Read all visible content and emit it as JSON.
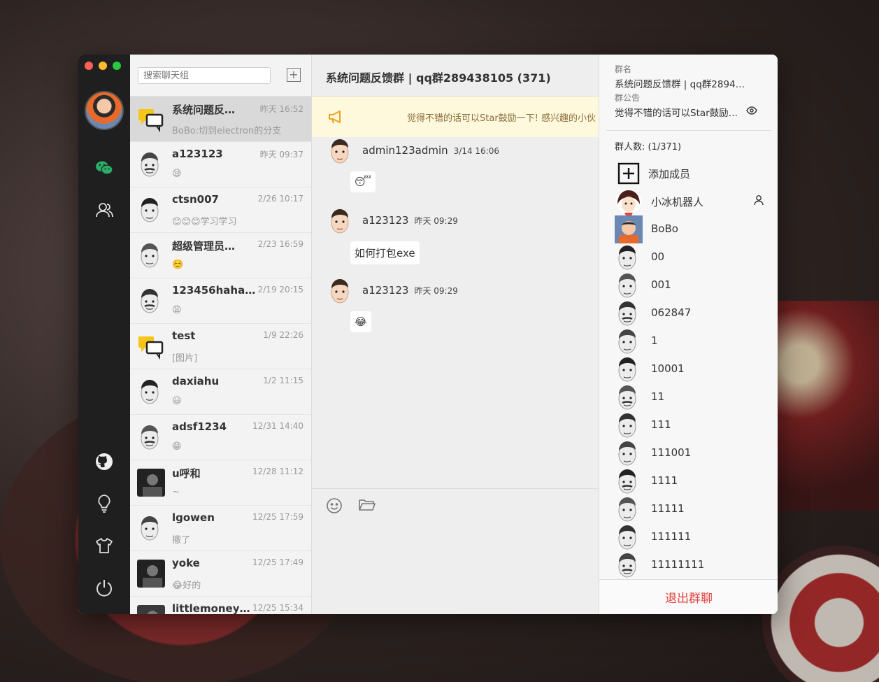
{
  "search": {
    "placeholder": "搜索聊天组"
  },
  "chat_list": [
    {
      "name": "系统问题反…",
      "time": "昨天 16:52",
      "msg": "BoBo:切到electron的分支",
      "avatar": "group-chat",
      "active": true
    },
    {
      "name": "a123123",
      "time": "昨天 09:37",
      "msg": "😪",
      "avatar": "cartoon-face"
    },
    {
      "name": "ctsn007",
      "time": "2/26 10:17",
      "msg": "😊😊😊学习学习",
      "avatar": "cartoon-face"
    },
    {
      "name": "超级管理员…",
      "time": "2/23 16:59",
      "msg": "☺️",
      "avatar": "cartoon-face"
    },
    {
      "name": "123456haha…",
      "time": "2/19 20:15",
      "msg": "😩",
      "avatar": "cartoon-face"
    },
    {
      "name": "test",
      "time": "1/9 22:26",
      "msg": "[图片]",
      "avatar": "group-chat"
    },
    {
      "name": "daxiahu",
      "time": "1/2 11:15",
      "msg": "😃",
      "avatar": "cartoon-face"
    },
    {
      "name": "adsf1234",
      "time": "12/31 14:40",
      "msg": "😁",
      "avatar": "cartoon-face"
    },
    {
      "name": "u呼和",
      "time": "12/28 11:12",
      "msg": "~",
      "avatar": "photo"
    },
    {
      "name": "lgowen",
      "time": "12/25 17:59",
      "msg": "撤了",
      "avatar": "cartoon-face"
    },
    {
      "name": "yoke",
      "time": "12/25 17:49",
      "msg": "😂好的",
      "avatar": "photo"
    },
    {
      "name": "littlemoney…",
      "time": "12/25 15:34",
      "msg": "",
      "avatar": "photo"
    }
  ],
  "chat": {
    "title": "系统问题反馈群 | qq群289438105 (371)",
    "notice": "觉得不错的话可以Star鼓励一下! 感兴趣的小伙",
    "messages": [
      {
        "user": "admin123admin",
        "time": "3/14 16:06",
        "content": "😴"
      },
      {
        "user": "a123123",
        "time": "昨天 09:29",
        "content": "如何打包exe"
      },
      {
        "user": "a123123",
        "time": "昨天 09:29",
        "content": "😂"
      }
    ]
  },
  "panel": {
    "group_name_label": "群名",
    "group_name": "系统问题反馈群 | qq群2894…",
    "notice_label": "群公告",
    "notice": "觉得不错的话可以Star鼓励…",
    "member_count": "群人数: (1/371)",
    "add_member": "添加成员",
    "members": [
      "小冰机器人",
      "BoBo",
      "00",
      "001",
      "062847",
      "1",
      "10001",
      "11",
      "111",
      "111001",
      "1111",
      "11111",
      "111111",
      "11111111"
    ],
    "quit": "退出群聊"
  },
  "colors": {
    "accent_green": "#2aae67",
    "quit_red": "#e0423a",
    "notice_bg": "#fef9dc"
  }
}
